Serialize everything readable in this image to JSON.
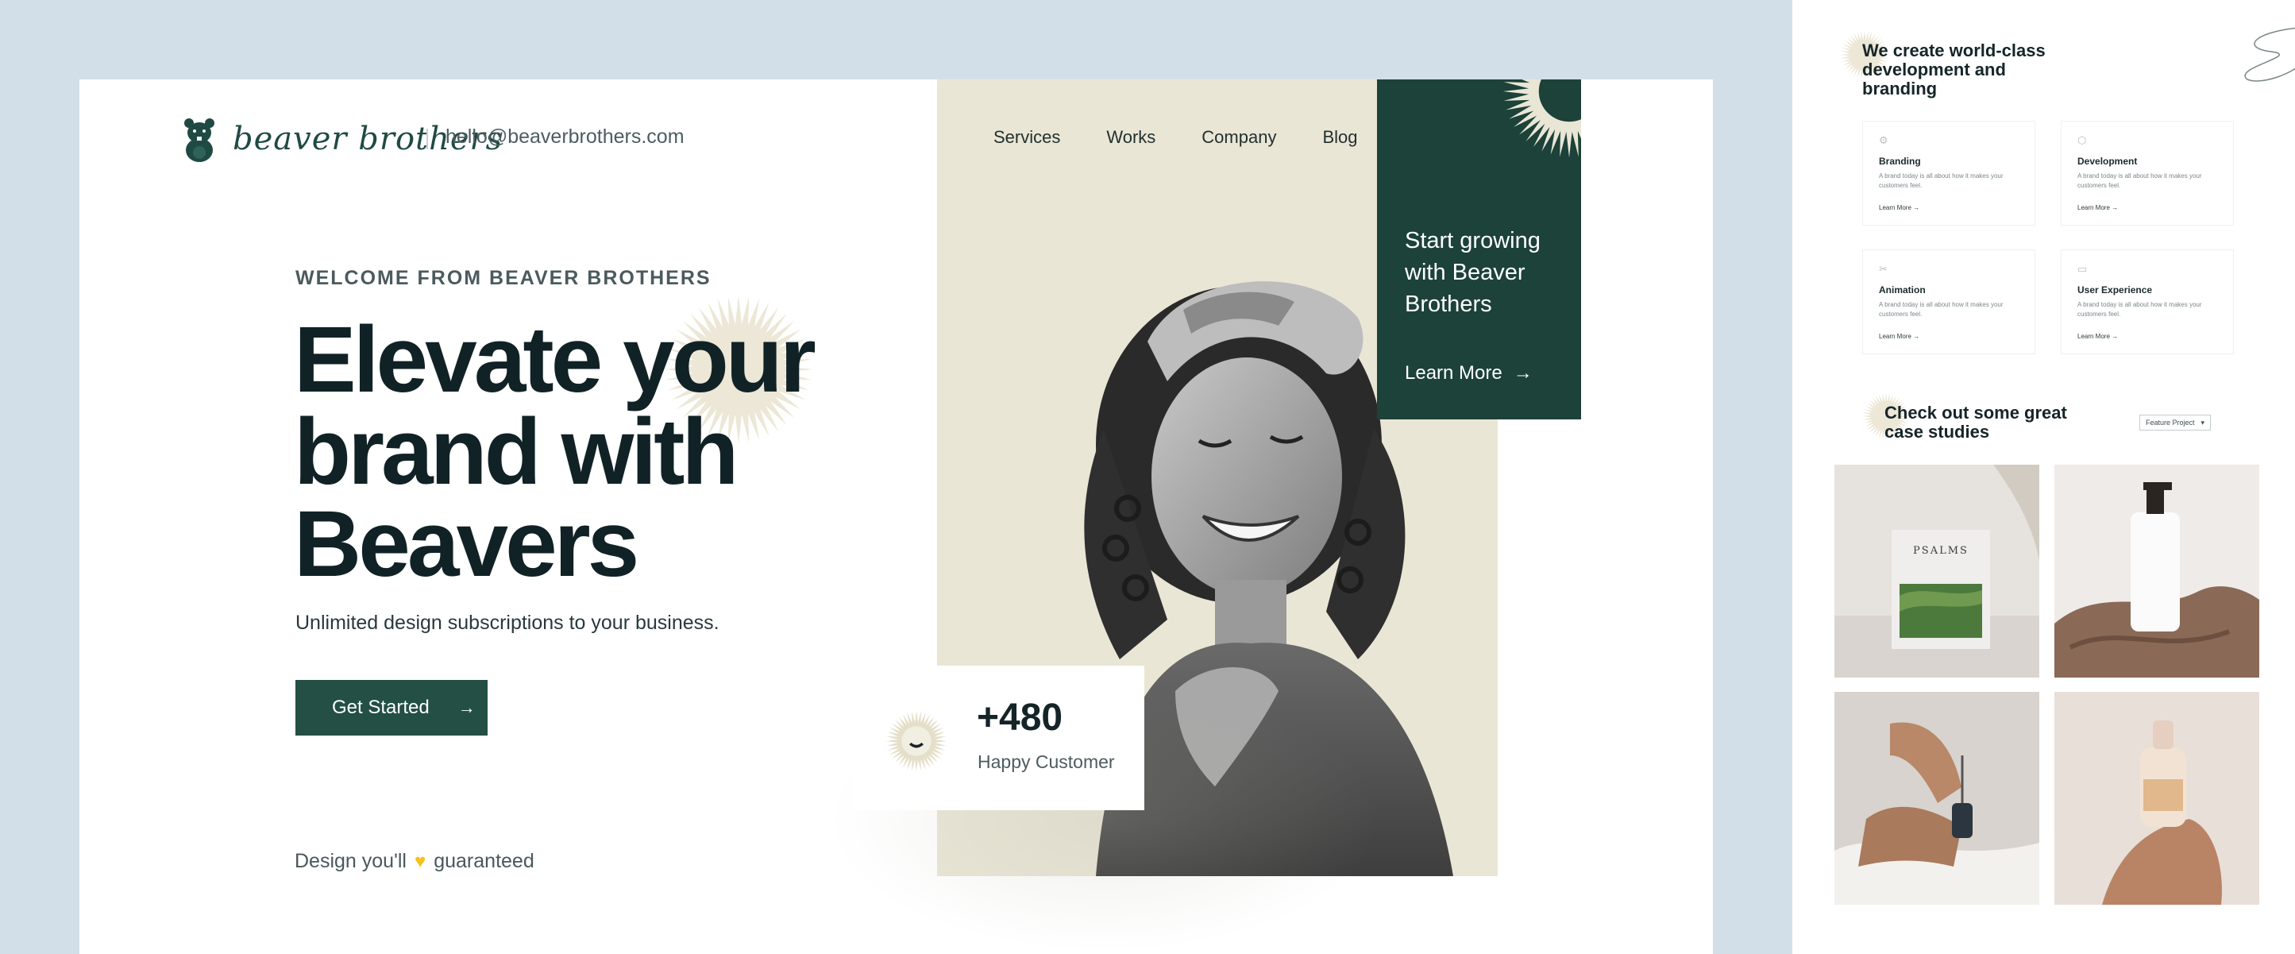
{
  "brand": {
    "name": "beaver brothers",
    "email": "hello@beaverbrothers.com"
  },
  "nav": [
    "Services",
    "Works",
    "Company",
    "Blog"
  ],
  "hero": {
    "eyebrow": "WELCOME FROM BEAVER BROTHERS",
    "headline_line1": "Elevate your",
    "headline_line2": "brand with",
    "headline_line3": "Beavers",
    "subtitle": "Unlimited design subscriptions to your business.",
    "cta_label": "Get Started",
    "guarantee_before": "Design you'll",
    "guarantee_after": "guaranteed"
  },
  "promo_card": {
    "title": "Start growing with Beaver Brothers",
    "link_label": "Learn More"
  },
  "stat": {
    "value": "+480",
    "label": "Happy Customer"
  },
  "side_panel": {
    "services_title": "We create world-class development and branding",
    "services": [
      {
        "name": "Branding",
        "desc": "A brand today is all about how it makes your customers feel.",
        "link": "Learn More"
      },
      {
        "name": "Development",
        "desc": "A brand today is all about how it makes your customers feel.",
        "link": "Learn More"
      },
      {
        "name": "Animation",
        "desc": "A brand today is all about how it makes your customers feel.",
        "link": "Learn More"
      },
      {
        "name": "User Experience",
        "desc": "A brand today is all about how it makes your customers feel.",
        "link": "Learn More"
      }
    ],
    "cases_title": "Check out some great case studies",
    "filter_label": "Feature Project",
    "case_book_text": "PSALMS"
  },
  "colors": {
    "page_bg": "#d3dfe8",
    "brand_green": "#1c4239",
    "button_green": "#234f45",
    "beige": "#eae6d6",
    "heart": "#f4c21f"
  },
  "icons": [
    "beaver-logo-icon",
    "arrow-right-icon",
    "heart-icon",
    "sunburst-icon",
    "chevron-down-icon"
  ]
}
